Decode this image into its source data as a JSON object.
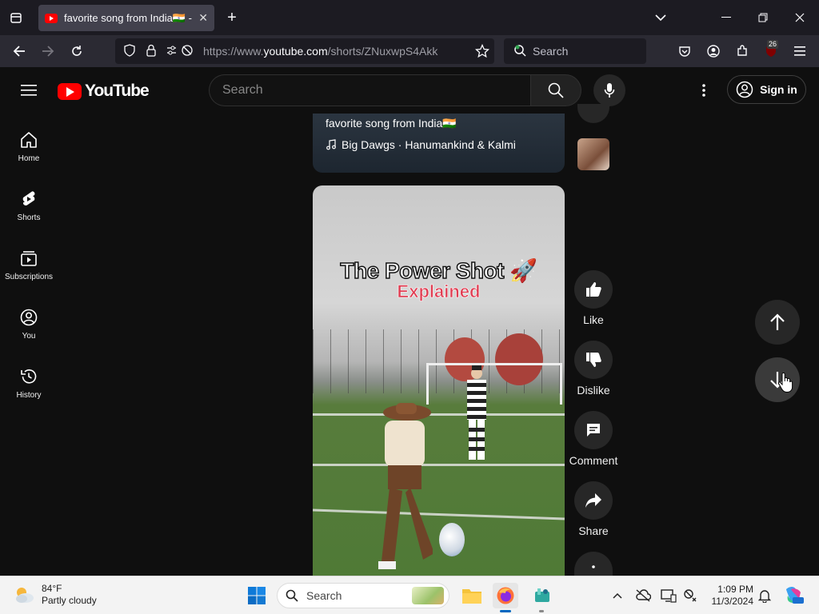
{
  "browser": {
    "tab_title": "favorite song from India🇮🇳 - Yo",
    "url_prefix": "https://www.",
    "url_domain": "youtube.com",
    "url_path": "/shorts/ZNuxwpS4Akk",
    "search_placeholder": "Search",
    "extension_badge": "26"
  },
  "youtube": {
    "logo_text": "YouTube",
    "search_placeholder": "Search",
    "signin_label": "Sign in",
    "sidebar": [
      {
        "label": "Home",
        "icon": "home-icon"
      },
      {
        "label": "Shorts",
        "icon": "shorts-icon"
      },
      {
        "label": "Subscriptions",
        "icon": "subscriptions-icon"
      },
      {
        "label": "You",
        "icon": "you-icon"
      },
      {
        "label": "History",
        "icon": "history-icon"
      }
    ]
  },
  "previous_short": {
    "title": "favorite song from India🇮🇳",
    "music": "Big Dawgs · Hanumankind & Kalmi"
  },
  "current_short": {
    "overlay_title": "The Power Shot 🚀",
    "overlay_subtitle": "Explained"
  },
  "actions": {
    "like": "Like",
    "dislike": "Dislike",
    "comment": "Comment",
    "share": "Share"
  },
  "taskbar": {
    "weather_temp": "84°F",
    "weather_desc": "Partly cloudy",
    "search_label": "Search",
    "time": "1:09 PM",
    "date": "11/3/2024"
  }
}
